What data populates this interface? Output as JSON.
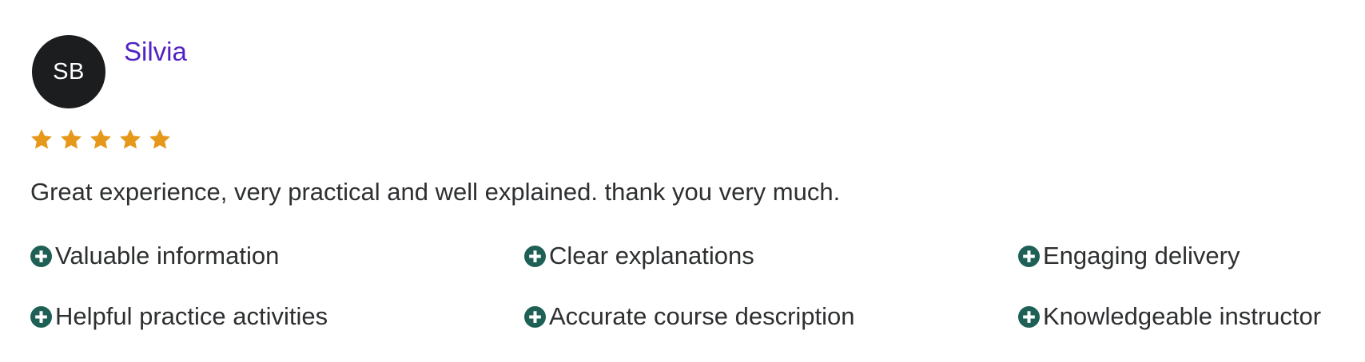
{
  "reviewer": {
    "initials": "SB",
    "name": "Silvia"
  },
  "rating": {
    "value": 5,
    "max": 5,
    "star_color": "#e59819"
  },
  "comment": "Great experience, very practical and well explained. thank you very much.",
  "tags": [
    {
      "label": "Valuable information",
      "icon": "plus-circle-icon"
    },
    {
      "label": "Clear explanations",
      "icon": "plus-circle-icon"
    },
    {
      "label": "Engaging delivery",
      "icon": "plus-circle-icon"
    },
    {
      "label": "Helpful practice activities",
      "icon": "plus-circle-icon"
    },
    {
      "label": "Accurate course description",
      "icon": "plus-circle-icon"
    },
    {
      "label": "Knowledgeable instructor",
      "icon": "plus-circle-icon"
    }
  ],
  "colors": {
    "avatar_bg": "#1c1d1f",
    "name": "#5022c3",
    "tag_icon": "#1e6055",
    "text": "#2d2f31"
  }
}
